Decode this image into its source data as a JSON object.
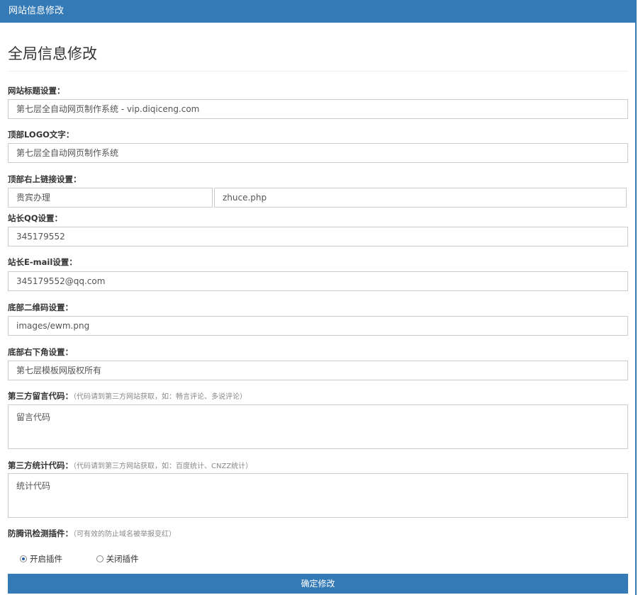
{
  "header": {
    "title": "网站信息修改"
  },
  "page_title": "全局信息修改",
  "fields": {
    "site_title": {
      "label": "网站标题设置：",
      "value": "第七层全自动网页制作系统 - vip.diqiceng.com"
    },
    "logo_text": {
      "label": "顶部LOGO文字：",
      "value": "第七层全自动网页制作系统"
    },
    "top_link": {
      "label": "顶部右上链接设置：",
      "text_value": "贵宾办理",
      "url_value": "zhuce.php"
    },
    "qq": {
      "label": "站长QQ设置：",
      "value": "345179552"
    },
    "email": {
      "label": "站长E-mail设置：",
      "value": "345179552@qq.com"
    },
    "qrcode": {
      "label": "底部二维码设置：",
      "value": "images/ewm.png"
    },
    "footer": {
      "label": "底部右下角设置：",
      "value": "第七层模板网版权所有"
    },
    "comment_code": {
      "label": "第三方留言代码：",
      "hint": "（代码请到第三方网站获取，如：畅言评论、多说评论）",
      "value": "留言代码"
    },
    "stats_code": {
      "label": "第三方统计代码：",
      "hint": "（代码请到第三方网站获取，如：百度统计、CNZZ统计）",
      "value": "统计代码"
    },
    "anti_tencent": {
      "label": "防腾讯检测插件：",
      "hint": "（可有效的防止域名被举报变红）",
      "options": [
        "开启插件",
        "关闭插件"
      ],
      "selected": "开启插件"
    }
  },
  "submit_label": "确定修改",
  "colors": {
    "accent": "#337ab7",
    "border": "#cccccc"
  }
}
